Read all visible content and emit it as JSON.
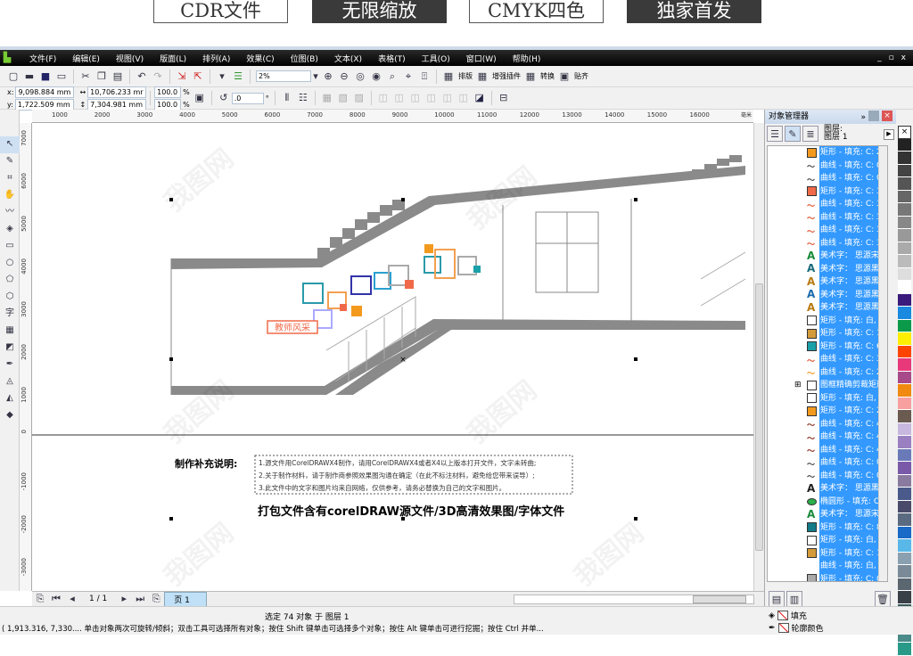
{
  "banner": [
    "CDR文件",
    "无限缩放",
    "CMYK四色",
    "独家首发"
  ],
  "menu": [
    "文件(F)",
    "编辑(E)",
    "视图(V)",
    "版面(L)",
    "排列(A)",
    "效果(C)",
    "位图(B)",
    "文本(X)",
    "表格(T)",
    "工具(O)",
    "窗口(W)",
    "帮助(H)"
  ],
  "window_controls": [
    "_",
    "▫",
    "x"
  ],
  "toolbar": {
    "icons": [
      "new-icon",
      "open-icon",
      "save-icon",
      "print-icon",
      "cut-icon",
      "copy-icon",
      "paste-icon",
      "undo-icon",
      "redo-icon",
      "import-icon",
      "export-icon",
      "app-launcher-icon",
      "options-icon"
    ],
    "zoom": "2%",
    "zoom_icons": [
      "zoom-in-icon",
      "zoom-out-icon",
      "zoom-selected-icon",
      "zoom-all-icon",
      "zoom-page-icon",
      "zoom-width-icon",
      "zoom-height-icon"
    ],
    "plugins": [
      "排版",
      "增强插件",
      "转换",
      "贴齐"
    ]
  },
  "props": {
    "x_label": "x:",
    "x": "9,098.884 mm",
    "y_label": "y:",
    "y": "1,722.509 mm",
    "w": "10,706.233 mr",
    "h": "7,304.981 mm",
    "sx": "100.0",
    "sy": "100.0",
    "pct": "%",
    "angle": ".0",
    "deg": "°"
  },
  "hruler": [
    "1000",
    "2000",
    "3000",
    "4000",
    "5000",
    "6000",
    "7000",
    "8000",
    "9000",
    "10000",
    "11000",
    "12000",
    "13000",
    "14000",
    "15000",
    "16000"
  ],
  "hruler_unit": "毫米",
  "vruler": [
    "7000",
    "6000",
    "5000",
    "4000",
    "3000",
    "2000",
    "1000",
    "0",
    "-1000",
    "-2000",
    "-3000"
  ],
  "canvas": {
    "note_title": "制作补充说明:",
    "notes": [
      "1.源文件用CorelDRAWX4制作，请用CorelDRAWX4或者X4以上版本打开文件，文字未转曲;",
      "2.关于制作材料，请于制作商参照效果图沟通在确定（在此不标注材料，避免给您带来误导）;",
      "3.此文件中的文字和图片均来自网络，仅供参考，请务必替换为自己的文字和图片。"
    ],
    "headline": "打包文件含有corelDRAW源文件/3D高清效果图/字体文件",
    "sign": "教师风采",
    "watermark": "我图网"
  },
  "object_manager": {
    "title": "对象管理器",
    "layer_label": "图层:",
    "layer": "图层 1",
    "rows": [
      [
        "矩形 - 填充: C: 2 M",
        "#f39a1e"
      ],
      [
        "曲线 - 填充: C: 0 M",
        "#444"
      ],
      [
        "曲线 - 填充: C: 0 M",
        "#444"
      ],
      [
        "矩形 - 填充: C: 3 M",
        "#f06a4a"
      ],
      [
        "曲线 - 填充: C: 3 M",
        "#e0502a"
      ],
      [
        "曲线 - 填充: C: 3 M",
        "#e0502a"
      ],
      [
        "曲线 - 填充: C: 3 M",
        "#e0502a"
      ],
      [
        "曲线 - 填充: C: 3 M",
        "#e0502a"
      ],
      [
        "美术字： 思源宋体 (",
        "#1a8a3a"
      ],
      [
        "美术字： 思源黑体 (",
        "#1a6a7a"
      ],
      [
        "美术字： 思源黑体 (",
        "#b87a10"
      ],
      [
        "美术字： 思源黑体 (",
        "#1a6aaa"
      ],
      [
        "美术字： 思源黑体 (",
        "#b87a10"
      ],
      [
        "矩形 - 填充: 白, 轮廓",
        "#fff"
      ],
      [
        "矩形 - 填充: C: 16 M",
        "#d49a3a"
      ],
      [
        "矩形 - 填充: C: 65 M",
        "#1aa0a8"
      ],
      [
        "曲线 - 填充: C: 3 M",
        "#e0502a"
      ],
      [
        "曲线 - 填充: C: 2 M",
        "#f39a1e"
      ],
      [
        "图框精确剪裁矩形 -",
        "#fff"
      ],
      [
        "矩形 - 填充: 白, 轮廓",
        "#fff"
      ],
      [
        "矩形 - 填充: C: 2 M",
        "#f39a1e"
      ],
      [
        "曲线 - 填充: C: 41 M",
        "#8a2a1a"
      ],
      [
        "曲线 - 填充: C: 41 M",
        "#8a2a1a"
      ],
      [
        "曲线 - 填充: C: 41 M",
        "#8a2a1a"
      ],
      [
        "曲线 - 填充: C: 0 M",
        "#444"
      ],
      [
        "曲线 - 填充: C: 0 M",
        "#444"
      ],
      [
        "美术字： 思源黑体 (",
        "#222"
      ],
      [
        "椭圆形 - 填充: C: 60",
        "#2ab04a"
      ],
      [
        "美术字： 思源宋体 (",
        "#1a8a3a"
      ],
      [
        "矩形 - 填充: C: 80 M",
        "#137a88"
      ],
      [
        "矩形 - 填充: 白, 轮廓",
        "#fff"
      ],
      [
        "矩形 - 填充: C: 16 M",
        "#d49a3a"
      ],
      [
        "曲线 - 填充: 白, 轮廓",
        "#fff"
      ],
      [
        "矩形 - 填充: C: 0 M",
        "#aaa"
      ]
    ]
  },
  "palette": [
    "#222",
    "#333",
    "#444",
    "#555",
    "#666",
    "#777",
    "#888",
    "#999",
    "#aaa",
    "#bbb",
    "#ddd",
    "#fff",
    "#3a1a7a",
    "#1a8ae0",
    "#0a9a4a",
    "#ffee00",
    "#ff4400",
    "#e83a7a",
    "#a84a8a",
    "#f08a10",
    "#f8a0a0",
    "#6a5a50",
    "#c8b8e0",
    "#9a80c0",
    "#6a7ab8",
    "#7a5aa8",
    "#8a7aa0",
    "#4a5a8a",
    "#4a4a6a",
    "#5a6a80",
    "#1a6ac8",
    "#5ab8e8",
    "#8aa0b0",
    "#7a8a98",
    "#5a6670",
    "#3a4048",
    "#3a5a5a",
    "#2a7a70",
    "#4a8a88",
    "#2a9a88"
  ],
  "pagebar": {
    "page_count": "1 / 1",
    "page_tab": "页 1"
  },
  "status": {
    "selection": "选定 74 对象 于 图层 1",
    "coords": "( 1,913.316, 7,330.... ",
    "hint": "单击对象两次可旋转/倾斜；双击工具可选择所有对象；按住 Shift 键单击可选择多个对象；按住 Alt 键单击可进行挖掘；按住 Ctrl 并单...",
    "fill_label": "填充",
    "outline_label": "轮廓颜色"
  }
}
